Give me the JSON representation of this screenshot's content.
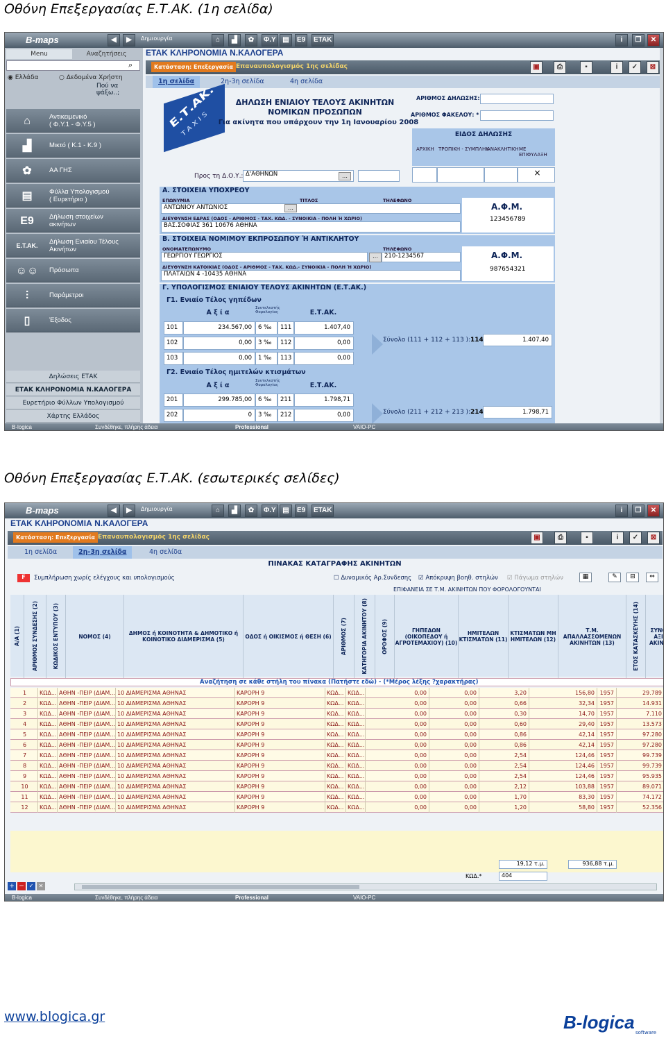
{
  "headings": {
    "h1": "Οθόνη Επεξεργασίας Ε.Τ.ΑΚ. (1η σελίδα)",
    "h2": "Οθόνη Επεξεργασίας Ε.Τ.ΑΚ. (εσωτερικές σελίδες)"
  },
  "app": {
    "logo": "B-maps",
    "toolbar": [
      "Δημιουργία",
      "Φ.Υ",
      "Ε9",
      "ΕΤΑΚ"
    ],
    "left_tabs": [
      "Menu",
      "Αναζητήσεις"
    ],
    "radio": [
      "Ελλάδα",
      "Δεδομένα Χρήστη"
    ],
    "search_hint": "Πού να ψάξω..;",
    "menu": [
      {
        "label1": "Αντικειμενικό",
        "label2": "( Φ.Υ.1 - Φ.Υ.5 )",
        "icon": "house-icon"
      },
      {
        "label1": "Μικτό ( Κ.1 - Κ.9 )",
        "label2": "",
        "icon": "factory-icon"
      },
      {
        "label1": "ΑΑ ΓΗΣ",
        "label2": "",
        "icon": "tree-icon"
      },
      {
        "label1": "Φύλλα Υπολογισμού",
        "label2": "( Ευρετήριο )",
        "icon": "sheets-icon"
      },
      {
        "label1": "Δήλωση στοιχείων",
        "label2": "ακινήτων",
        "icon": "e9-icon"
      },
      {
        "label1": "Δήλωση Ενιαίου Τέλους",
        "label2": "Ακινήτων",
        "icon": "etak-icon"
      },
      {
        "label1": "Πρόσωπα",
        "label2": "",
        "icon": "people-icon"
      },
      {
        "label1": "Παράμετροι",
        "label2": "",
        "icon": "sliders-icon"
      },
      {
        "label1": "Έξοδος",
        "label2": "",
        "icon": "door-icon"
      }
    ],
    "bottom_links": [
      "Δηλώσεις ΕΤΑΚ",
      "ΕΤΑΚ ΚΛΗΡΟΝΟΜΙΑ Ν.ΚΑΛΟΓΕΡΑ",
      "Ευρετήριο Φύλλων Υπολογισμού",
      "Χάρτης Ελλάδος"
    ],
    "doc_title": "ΕΤΑΚ ΚΛΗΡΟΝΟΜΙΑ Ν.ΚΑΛΟΓΕΡΑ",
    "status_label": "Κατάσταση: Επεξεργασία",
    "recalc_link": "Επαναυπολογισμός 1ης σελίδας",
    "tabs": [
      "1η σελίδα",
      "2η-3η σελίδα",
      "4η σελίδα"
    ],
    "statusbar": [
      "B-logica",
      "Συνδέθηκε, πλήρης άδεια",
      "Professional",
      "VAIO-PC"
    ]
  },
  "form": {
    "stamp_main": "Ε.Τ.ΑΚ.",
    "stamp_sub": "TAXIS",
    "title1": "ΔΗΛΩΣΗ ΕΝΙΑΙΟΥ ΤΕΛΟΥΣ ΑΚΙΝΗΤΩΝ",
    "title2": "ΝΟΜΙΚΩΝ ΠΡΟΣΩΠΩΝ",
    "title3": "Για ακίνητα που υπάρχουν την 1η Ιανουαρίου 2008",
    "arithmos_dilosis": "ΑΡΙΘΜΟΣ ΔΗΛΩΣΗΣ: *",
    "arithmos_fakelou": "ΑΡΙΘΜΟΣ ΦΑΚΕΛΟΥ: *",
    "eidos": "ΕΙΔΟΣ ΔΗΛΩΣΗΣ",
    "eidos_cols": [
      "ΑΡΧΙΚΗ",
      "ΤΡΟΠΙΚΗ - ΣΥΜΠΛΗΚ",
      "ΑΝΑΚΛΗΤΙΚΗ",
      "ΜΕ ΕΠΙΦΥΛΑΞΗ"
    ],
    "eidos_mark": "×",
    "pros_doy": "Προς τη Δ.Ο.Υ.:",
    "doy": "Δ'ΑΘΗΝΩΝ",
    "secA": "Α. ΣΤΟΙΧΕΙΑ ΥΠΟΧΡΕΟΥ",
    "eponymia_lbl": "ΕΠΩΝΥΜΙΑ",
    "titlos_lbl": "ΤΙΤΛΟΣ",
    "tilefono_lbl": "ΤΗΛΕΦΩΝΟ",
    "eponymia": "ΑΝΤΩΝΙΟΥ ΑΝΤΩΝΙΟΣ",
    "afm_lbl": "Α.Φ.Μ.",
    "afm1": "123456789",
    "edra_lbl": "ΔΙΕΥΘΥΝΣΗ ΕΔΡΑΣ (ΟΔΟΣ - ΑΡΙΘΜΟΣ - ΤΑΧ. ΚΩΔ. - ΣΥΝΟΙΚΙΑ - ΠΟΛΗ Ή ΧΩΡΙΟ)",
    "edra": "ΒΑΣ.ΣΟΦΙΑΣ 361 10676 ΑΘΗΝΑ",
    "secB": "Β. ΣΤΟΙΧΕΙΑ ΝΟΜΙΜΟΥ ΕΚΠΡΟΣΩΠΟΥ Ή ΑΝΤΙΚΛΗΤΟΥ",
    "onomat_lbl": "ΟΝΟΜΑΤΕΠΩΝΥΜΟ",
    "onomat": "ΓΕΩΡΓΙΟΥ ΓΕΩΡΓΙΟΣ",
    "tilefono2": "210-1234567",
    "afm2": "987654321",
    "katoikia_lbl": "ΔΙΕΥΘΥΝΣΗ ΚΑΤΟΙΚΙΑΣ (ΟΔΟΣ - ΑΡΙΘΜΟΣ - ΤΑΧ. ΚΩΔ.- ΣΥΝΟΙΚΙΑ - ΠΟΛΗ Ή ΧΩΡΙΟ)",
    "katoikia": "ΠΛΑΤΑΙΩΝ 4 -10435 ΑΘΗΝΑ",
    "secG": "Γ. ΥΠΟΛΟΓΙΣΜΟΣ ΕΝΙΑΙΟΥ ΤΕΛΟΥΣ ΑΚΙΝΗΤΩΝ (Ε.Τ.ΑΚ.)",
    "g1": "Γ1. Ενιαίο Τέλος γηπέδων",
    "g2": "Γ2. Ενιαίο Τέλος ημιτελών κτισμάτων",
    "col_axia": "Α ξ ί α",
    "col_syntel": "Συντελεστής Φορολογίας",
    "col_etak": "Ε.Τ.ΑΚ.",
    "g1_rows": [
      {
        "code": "101",
        "axia": "234.567,00",
        "rate": "6 ‰",
        "code2": "111",
        "etak": "1.407,40"
      },
      {
        "code": "102",
        "axia": "0,00",
        "rate": "3 ‰",
        "code2": "112",
        "etak": "0,00"
      },
      {
        "code": "103",
        "axia": "0,00",
        "rate": "1 ‰",
        "code2": "113",
        "etak": "0,00"
      }
    ],
    "g2_rows": [
      {
        "code": "201",
        "axia": "299.785,00",
        "rate": "6 ‰",
        "code2": "211",
        "etak": "1.798,71"
      },
      {
        "code": "202",
        "axia": "0",
        "rate": "3 ‰",
        "code2": "212",
        "etak": "0,00"
      }
    ],
    "sum1_lbl": "Σύνολο (111 + 112 + 113 ):",
    "sum1_code": "114",
    "sum1": "1.407,40",
    "sum2_lbl": "Σύνολο (211 + 212 + 213 ):",
    "sum2_code": "214",
    "sum2": "1.798,71"
  },
  "grid": {
    "title": "ΠΙΝΑΚΑΣ ΚΑΤΑΓΡΑΦΗΣ ΑΚΙΝΗΤΩΝ",
    "fbtn": "F",
    "fill_label": "Συμπλήρωση χωρίς ελέγχους και υπολογισμούς",
    "opt1": "Δυναμικός Αρ.Συνδεσης",
    "opt2": "Απόκρυψη βοηθ. στηλών",
    "opt3": "Πάγωμα στηλών",
    "group_header": "ΕΠΙΦΑΝΕΙΑ ΣΕ Τ.Μ. ΑΚΙΝΗΤΩΝ ΠΟΥ ΦΟΡΟΛΟΓΟΥΝΤΑΙ",
    "columns": [
      "Α/Α (1)",
      "ΑΡΙΘΜΟΣ ΣΥΝΔΕΣΗΣ (2)",
      "ΚΩΔΙΚΟΣ ΕΝΤΥΠΟΥ (3)",
      "ΝΟΜΟΣ (4)",
      "ΔΗΜΟΣ ή ΚΟΙΝΟΤΗΤΑ & ΔΗΜΟΤΙΚΟ ή ΚΟΙΝΟΤΙΚΟ ΔΙΑΜΕΡΙΣΜΑ (5)",
      "ΟΔΟΣ ή ΟΙΚΙΣΜΟΣ ή ΘΕΣΗ (6)",
      "ΑΡΙΘΜΟΣ (7)",
      "ΚΑΤΗΓΟΡΙΑ ΑΚΙΝΗΤΟΥ (8)",
      "ΟΡΟΦΟΣ (9)",
      "ΓΗΠΕΔΩΝ (ΟΙΚΟΠΕΔΟΥ ή ΑΓΡΟΤΕΜΑΧΙΟΥ) (10)",
      "ΗΜΙΤΕΛΩΝ ΚΤΙΣΜΑΤΩΝ (11)",
      "ΚΤΙΣΜΑΤΩΝ ΜΗ ΗΜΙΤΕΛΩΝ (12)",
      "Τ.Μ. ΑΠΑΛΛΑΣΣΟΜΕΝΩΝ ΑΚΙΝΗΤΩΝ (13)",
      "ΕΤΟΣ ΚΑΤΑΣΚΕΥΗΣ (14)",
      "ΣΥΝΟΛ ΑΞΙΑ ΑΚΙΝΗΤ"
    ],
    "search_row": "Αναζήτηση σε κάθε στήλη του πίνακα (Πατήστε εδώ) - (*Μέρος λέξης ?χαρακτήρας)",
    "rows": [
      [
        "1",
        "ΚΩΔ...",
        "ΑΘΗΝ -ΠΕΙΡ (ΔΙΑΜ...",
        "10 ΔΙΑΜΕΡΙΣΜΑ ΑΘΗΝΑΣ",
        "ΚΑΡΟΡΗ 9",
        "ΚΩΔ...",
        "ΚΩΔ...",
        "0,00",
        "0,00",
        "3,20",
        "156,80",
        "1957",
        "29.789"
      ],
      [
        "2",
        "ΚΩΔ...",
        "ΑΘΗΝ -ΠΕΙΡ (ΔΙΑΜ...",
        "10 ΔΙΑΜΕΡΙΣΜΑ ΑΘΗΝΑΣ",
        "ΚΑΡΟΡΗ 9",
        "ΚΩΔ...",
        "ΚΩΔ...",
        "0,00",
        "0,00",
        "0,66",
        "32,34",
        "1957",
        "14.931"
      ],
      [
        "3",
        "ΚΩΔ...",
        "ΑΘΗΝ -ΠΕΙΡ (ΔΙΑΜ...",
        "10 ΔΙΑΜΕΡΙΣΜΑ ΑΘΗΝΑΣ",
        "ΚΑΡΟΡΗ 9",
        "ΚΩΔ...",
        "ΚΩΔ...",
        "0,00",
        "0,00",
        "0,30",
        "14,70",
        "1957",
        "7.110"
      ],
      [
        "4",
        "ΚΩΔ...",
        "ΑΘΗΝ -ΠΕΙΡ (ΔΙΑΜ...",
        "10 ΔΙΑΜΕΡΙΣΜΑ ΑΘΗΝΑΣ",
        "ΚΑΡΟΡΗ 9",
        "ΚΩΔ...",
        "ΚΩΔ...",
        "0,00",
        "0,00",
        "0,60",
        "29,40",
        "1957",
        "13.573"
      ],
      [
        "5",
        "ΚΩΔ...",
        "ΑΘΗΝ -ΠΕΙΡ (ΔΙΑΜ...",
        "10 ΔΙΑΜΕΡΙΣΜΑ ΑΘΗΝΑΣ",
        "ΚΑΡΟΡΗ 9",
        "ΚΩΔ...",
        "ΚΩΔ...",
        "0,00",
        "0,00",
        "0,86",
        "42,14",
        "1957",
        "97.280"
      ],
      [
        "6",
        "ΚΩΔ...",
        "ΑΘΗΝ -ΠΕΙΡ (ΔΙΑΜ...",
        "10 ΔΙΑΜΕΡΙΣΜΑ ΑΘΗΝΑΣ",
        "ΚΑΡΟΡΗ 9",
        "ΚΩΔ...",
        "ΚΩΔ...",
        "0,00",
        "0,00",
        "0,86",
        "42,14",
        "1957",
        "97.280"
      ],
      [
        "7",
        "ΚΩΔ...",
        "ΑΘΗΝ -ΠΕΙΡ (ΔΙΑΜ...",
        "10 ΔΙΑΜΕΡΙΣΜΑ ΑΘΗΝΑΣ",
        "ΚΑΡΟΡΗ 9",
        "ΚΩΔ...",
        "ΚΩΔ...",
        "0,00",
        "0,00",
        "2,54",
        "124,46",
        "1957",
        "99.739"
      ],
      [
        "8",
        "ΚΩΔ...",
        "ΑΘΗΝ -ΠΕΙΡ (ΔΙΑΜ...",
        "10 ΔΙΑΜΕΡΙΣΜΑ ΑΘΗΝΑΣ",
        "ΚΑΡΟΡΗ 9",
        "ΚΩΔ...",
        "ΚΩΔ...",
        "0,00",
        "0,00",
        "2,54",
        "124,46",
        "1957",
        "99.739"
      ],
      [
        "9",
        "ΚΩΔ...",
        "ΑΘΗΝ -ΠΕΙΡ (ΔΙΑΜ...",
        "10 ΔΙΑΜΕΡΙΣΜΑ ΑΘΗΝΑΣ",
        "ΚΑΡΟΡΗ 9",
        "ΚΩΔ...",
        "ΚΩΔ...",
        "0,00",
        "0,00",
        "2,54",
        "124,46",
        "1957",
        "95.935"
      ],
      [
        "10",
        "ΚΩΔ...",
        "ΑΘΗΝ -ΠΕΙΡ (ΔΙΑΜ...",
        "10 ΔΙΑΜΕΡΙΣΜΑ ΑΘΗΝΑΣ",
        "ΚΑΡΟΡΗ 9",
        "ΚΩΔ...",
        "ΚΩΔ...",
        "0,00",
        "0,00",
        "2,12",
        "103,88",
        "1957",
        "89.071"
      ],
      [
        "11",
        "ΚΩΔ...",
        "ΑΘΗΝ -ΠΕΙΡ (ΔΙΑΜ...",
        "10 ΔΙΑΜΕΡΙΣΜΑ ΑΘΗΝΑΣ",
        "ΚΑΡΟΡΗ 9",
        "ΚΩΔ...",
        "ΚΩΔ...",
        "0,00",
        "0,00",
        "1,70",
        "83,30",
        "1957",
        "74.172"
      ],
      [
        "12",
        "ΚΩΔ...",
        "ΑΘΗΝ -ΠΕΙΡ (ΔΙΑΜ...",
        "10 ΔΙΑΜΕΡΙΣΜΑ ΑΘΗΝΑΣ",
        "ΚΑΡΟΡΗ 9",
        "ΚΩΔ...",
        "ΚΩΔ...",
        "0,00",
        "0,00",
        "1,20",
        "58,80",
        "1957",
        "52.356"
      ]
    ],
    "total_m2": "19,12 τ.μ.",
    "total_m2b": "936,88 τ.μ.",
    "kod_label": "ΚΩΔ.*",
    "kod_value": "404"
  },
  "footer": {
    "url": "www.blogica.gr",
    "brand": "B-logica",
    "brand_sub": "software"
  }
}
